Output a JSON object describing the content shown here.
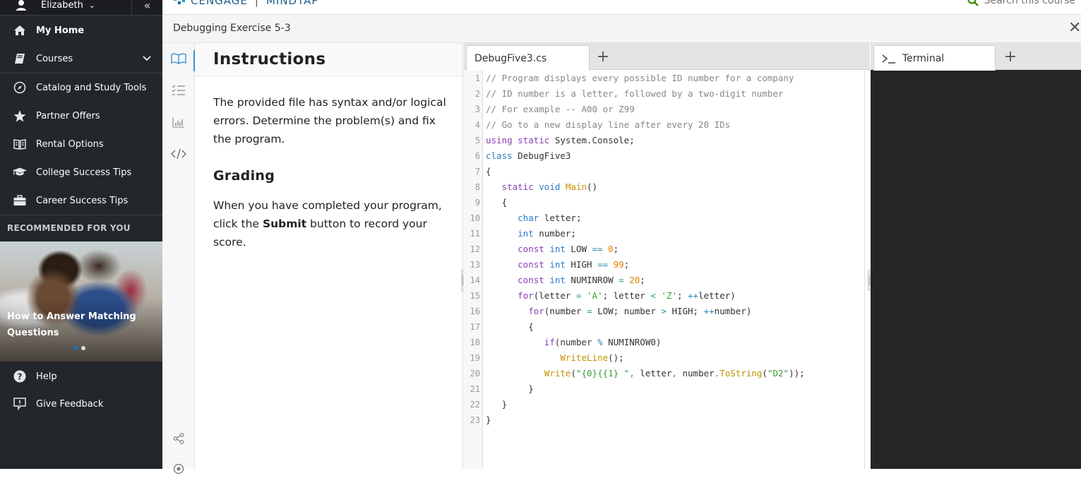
{
  "sidebar": {
    "user_name": "Elizabeth",
    "items": [
      {
        "label": "My Home",
        "icon": "home-icon"
      },
      {
        "label": "Courses",
        "icon": "book-icon",
        "expandable": true
      },
      {
        "label": "Catalog and Study Tools",
        "icon": "compass-icon"
      },
      {
        "label": "Partner Offers",
        "icon": "star-icon"
      },
      {
        "label": "Rental Options",
        "icon": "open-book-icon"
      },
      {
        "label": "College Success Tips",
        "icon": "graduation-cap-icon"
      },
      {
        "label": "Career Success Tips",
        "icon": "briefcase-icon"
      }
    ],
    "recommended_heading": "RECOMMENDED FOR YOU",
    "promo": {
      "title": "How to Answer Matching Questions",
      "slide_count": 2,
      "active_slide": 1
    },
    "footer_items": [
      {
        "label": "Help",
        "icon": "help-icon"
      },
      {
        "label": "Give Feedback",
        "icon": "feedback-icon"
      }
    ]
  },
  "header": {
    "brand": "CENGAGE",
    "product": "MINDTAP",
    "search_placeholder": "Search this course"
  },
  "activity": {
    "title": "Debugging Exercise 5-3"
  },
  "rail": {
    "buttons": [
      {
        "name": "instructions",
        "icon": "open-book-icon",
        "active": true
      },
      {
        "name": "checklist",
        "icon": "checklist-icon"
      },
      {
        "name": "results",
        "icon": "bar-chart-icon"
      },
      {
        "name": "code",
        "icon": "code-icon"
      },
      {
        "name": "share",
        "icon": "share-icon"
      }
    ]
  },
  "instructions": {
    "title": "Instructions",
    "paragraph1": "The provided file has syntax and/or logical errors. Determine the problem(s) and fix the program.",
    "grading_heading": "Grading",
    "grading_pre": "When you have completed your program, click the ",
    "grading_bold": "Submit",
    "grading_post": " button to record your score."
  },
  "editor": {
    "tabs": [
      {
        "label": "DebugFive3.cs",
        "active": true
      }
    ],
    "add_tab_label": "+",
    "lines": [
      [
        [
          "c-com",
          "// Program displays every possible ID number for a company"
        ]
      ],
      [
        [
          "c-com",
          "// ID number is a letter, followed by a two-digit number"
        ]
      ],
      [
        [
          "c-com",
          "// For example -- A00 or Z99"
        ]
      ],
      [
        [
          "c-com",
          "// Go to a new display line after every 20 IDs"
        ]
      ],
      [
        [
          "c-kw",
          "using"
        ],
        [
          "",
          " "
        ],
        [
          "c-kw",
          "static"
        ],
        [
          "",
          " System.Console;"
        ]
      ],
      [
        [
          "c-ty",
          "class"
        ],
        [
          "",
          " DebugFive3"
        ]
      ],
      [
        [
          "",
          "{"
        ]
      ],
      [
        [
          "",
          "   "
        ],
        [
          "c-kw",
          "static"
        ],
        [
          "",
          " "
        ],
        [
          "c-ty",
          "void"
        ],
        [
          "",
          " "
        ],
        [
          "c-fn",
          "Main"
        ],
        [
          "",
          "()"
        ]
      ],
      [
        [
          "",
          "   {"
        ]
      ],
      [
        [
          "",
          "      "
        ],
        [
          "c-ty",
          "char"
        ],
        [
          "",
          " letter;"
        ]
      ],
      [
        [
          "",
          "      "
        ],
        [
          "c-ty",
          "int"
        ],
        [
          "",
          " number;"
        ]
      ],
      [
        [
          "",
          "      "
        ],
        [
          "c-kw",
          "const"
        ],
        [
          "",
          " "
        ],
        [
          "c-ty",
          "int"
        ],
        [
          "",
          " LOW "
        ],
        [
          "c-op",
          "=="
        ],
        [
          "",
          " "
        ],
        [
          "c-num",
          "0"
        ],
        [
          "",
          ";"
        ]
      ],
      [
        [
          "",
          "      "
        ],
        [
          "c-kw",
          "const"
        ],
        [
          "",
          " "
        ],
        [
          "c-ty",
          "int"
        ],
        [
          "",
          " HIGH "
        ],
        [
          "c-op",
          "=="
        ],
        [
          "",
          " "
        ],
        [
          "c-num",
          "99"
        ],
        [
          "",
          ";"
        ]
      ],
      [
        [
          "",
          "      "
        ],
        [
          "c-kw",
          "const"
        ],
        [
          "",
          " "
        ],
        [
          "c-ty",
          "int"
        ],
        [
          "",
          " NUMINROW "
        ],
        [
          "c-op",
          "="
        ],
        [
          "",
          " "
        ],
        [
          "c-num",
          "20"
        ],
        [
          "",
          ";"
        ]
      ],
      [
        [
          "",
          "      "
        ],
        [
          "c-kw",
          "for"
        ],
        [
          "",
          "(letter "
        ],
        [
          "c-op",
          "="
        ],
        [
          "",
          " "
        ],
        [
          "c-str",
          "'A'"
        ],
        [
          "",
          "; letter "
        ],
        [
          "c-op",
          "<"
        ],
        [
          "",
          " "
        ],
        [
          "c-str",
          "'Z'"
        ],
        [
          "",
          "; "
        ],
        [
          "c-op",
          "++"
        ],
        [
          "",
          "letter)"
        ]
      ],
      [
        [
          "",
          "        "
        ],
        [
          "c-kw",
          "for"
        ],
        [
          "",
          "(number "
        ],
        [
          "c-op",
          "="
        ],
        [
          "",
          " LOW; number "
        ],
        [
          "c-op",
          ">"
        ],
        [
          "",
          " HIGH; "
        ],
        [
          "c-op",
          "++"
        ],
        [
          "",
          "number)"
        ]
      ],
      [
        [
          "",
          "        {"
        ]
      ],
      [
        [
          "",
          "           "
        ],
        [
          "c-kw",
          "if"
        ],
        [
          "",
          "(number "
        ],
        [
          "c-op",
          "%"
        ],
        [
          "",
          " NUMINROW0)"
        ]
      ],
      [
        [
          "",
          "              "
        ],
        [
          "c-fn",
          "WriteLine"
        ],
        [
          "",
          "();"
        ]
      ],
      [
        [
          "",
          "           "
        ],
        [
          "c-fn",
          "Write"
        ],
        [
          "",
          "("
        ],
        [
          "c-str",
          "\"{0}{{1} \""
        ],
        [
          "c-op",
          ","
        ],
        [
          "",
          " letter"
        ],
        [
          "c-op",
          ","
        ],
        [
          "",
          " number"
        ],
        [
          "c-op",
          "."
        ],
        [
          "c-fn",
          "ToString"
        ],
        [
          "",
          "("
        ],
        [
          "c-str",
          "\"D2\""
        ],
        [
          "",
          "));"
        ]
      ],
      [
        [
          "",
          "        }"
        ]
      ],
      [
        [
          "",
          "   }"
        ]
      ],
      [
        [
          "",
          "}"
        ]
      ]
    ]
  },
  "terminal": {
    "tabs": [
      {
        "label": "Terminal",
        "icon": "terminal-prompt-icon",
        "active": true
      }
    ],
    "add_tab_label": "+"
  },
  "colors": {
    "sidebar_bg": "#23272b",
    "accent": "#3c8fd0",
    "terminal_bg": "#262626",
    "search_icon": "#3a8a00"
  }
}
